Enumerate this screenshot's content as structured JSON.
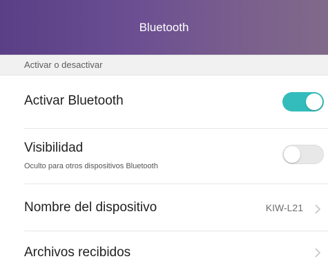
{
  "header": {
    "title": "Bluetooth",
    "gradient_colors": [
      "#5a3f86",
      "#806a8a"
    ]
  },
  "section": {
    "label": "Activar o desactivar"
  },
  "settings": {
    "bluetooth": {
      "title": "Activar Bluetooth",
      "enabled": true,
      "accent": "#34bcbc"
    },
    "visibility": {
      "title": "Visibilidad",
      "subtitle": "Oculto para otros dispositivos Bluetooth",
      "enabled": false
    },
    "device_name": {
      "title": "Nombre del dispositivo",
      "value": "KIW-L21",
      "icon": "chevron-right-icon"
    },
    "received_files": {
      "title": "Archivos recibidos",
      "icon": "chevron-right-icon"
    }
  }
}
